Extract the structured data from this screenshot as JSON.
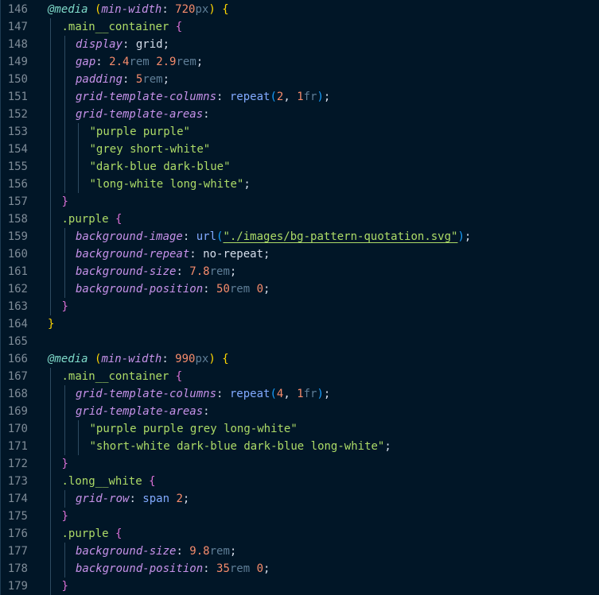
{
  "editor": {
    "theme_colors": {
      "background": "#011627",
      "line_number": "#7f8c98",
      "at_rule": "#7fdbca",
      "property": "#c792ea",
      "selector": "#addb67",
      "number": "#f78c6c",
      "unit": "#5f7e97",
      "string": "#addb67",
      "function": "#82aaff",
      "brace_level_1": "#ffd700",
      "brace_level_2": "#da70d6",
      "brace_level_3": "#179fff"
    },
    "lines": [
      {
        "n": "146",
        "indent": 0,
        "tokens": [
          {
            "c": "at",
            "t": "@media"
          },
          {
            "c": "punct",
            "t": " "
          },
          {
            "c": "brace1",
            "t": "("
          },
          {
            "c": "prop",
            "t": "min-width"
          },
          {
            "c": "punct",
            "t": ": "
          },
          {
            "c": "num",
            "t": "720"
          },
          {
            "c": "unit",
            "t": "px"
          },
          {
            "c": "brace1",
            "t": ")"
          },
          {
            "c": "punct",
            "t": " "
          },
          {
            "c": "brace1",
            "t": "{"
          }
        ]
      },
      {
        "n": "147",
        "indent": 1,
        "tokens": [
          {
            "c": "sel",
            "t": ".main__container"
          },
          {
            "c": "punct",
            "t": " "
          },
          {
            "c": "brace2",
            "t": "{"
          }
        ]
      },
      {
        "n": "148",
        "indent": 2,
        "tokens": [
          {
            "c": "prop",
            "t": "display"
          },
          {
            "c": "punct",
            "t": ": "
          },
          {
            "c": "val",
            "t": "grid"
          },
          {
            "c": "punct",
            "t": ";"
          }
        ]
      },
      {
        "n": "149",
        "indent": 2,
        "tokens": [
          {
            "c": "prop",
            "t": "gap"
          },
          {
            "c": "punct",
            "t": ": "
          },
          {
            "c": "num",
            "t": "2.4"
          },
          {
            "c": "unit",
            "t": "rem"
          },
          {
            "c": "punct",
            "t": " "
          },
          {
            "c": "num",
            "t": "2.9"
          },
          {
            "c": "unit",
            "t": "rem"
          },
          {
            "c": "punct",
            "t": ";"
          }
        ]
      },
      {
        "n": "150",
        "indent": 2,
        "tokens": [
          {
            "c": "prop",
            "t": "padding"
          },
          {
            "c": "punct",
            "t": ": "
          },
          {
            "c": "num",
            "t": "5"
          },
          {
            "c": "unit",
            "t": "rem"
          },
          {
            "c": "punct",
            "t": ";"
          }
        ]
      },
      {
        "n": "151",
        "indent": 2,
        "tokens": [
          {
            "c": "prop",
            "t": "grid-template-columns"
          },
          {
            "c": "punct",
            "t": ": "
          },
          {
            "c": "func",
            "t": "repeat"
          },
          {
            "c": "brace3",
            "t": "("
          },
          {
            "c": "num",
            "t": "2"
          },
          {
            "c": "punct",
            "t": ", "
          },
          {
            "c": "num",
            "t": "1"
          },
          {
            "c": "unit",
            "t": "fr"
          },
          {
            "c": "brace3",
            "t": ")"
          },
          {
            "c": "punct",
            "t": ";"
          }
        ]
      },
      {
        "n": "152",
        "indent": 2,
        "tokens": [
          {
            "c": "prop",
            "t": "grid-template-areas"
          },
          {
            "c": "punct",
            "t": ":"
          }
        ]
      },
      {
        "n": "153",
        "indent": 3,
        "tokens": [
          {
            "c": "str",
            "t": "\"purple purple\""
          }
        ]
      },
      {
        "n": "154",
        "indent": 3,
        "tokens": [
          {
            "c": "str",
            "t": "\"grey short-white\""
          }
        ]
      },
      {
        "n": "155",
        "indent": 3,
        "tokens": [
          {
            "c": "str",
            "t": "\"dark-blue dark-blue\""
          }
        ]
      },
      {
        "n": "156",
        "indent": 3,
        "tokens": [
          {
            "c": "str",
            "t": "\"long-white long-white\""
          },
          {
            "c": "punct",
            "t": ";"
          }
        ]
      },
      {
        "n": "157",
        "indent": 1,
        "tokens": [
          {
            "c": "brace2",
            "t": "}"
          }
        ]
      },
      {
        "n": "158",
        "indent": 1,
        "tokens": [
          {
            "c": "sel",
            "t": ".purple"
          },
          {
            "c": "punct",
            "t": " "
          },
          {
            "c": "brace2",
            "t": "{"
          }
        ]
      },
      {
        "n": "159",
        "indent": 2,
        "tokens": [
          {
            "c": "prop",
            "t": "background-image"
          },
          {
            "c": "punct",
            "t": ": "
          },
          {
            "c": "func",
            "t": "url"
          },
          {
            "c": "brace3",
            "t": "("
          },
          {
            "c": "link",
            "t": "\"./images/bg-pattern-quotation.svg\""
          },
          {
            "c": "brace3",
            "t": ")"
          },
          {
            "c": "punct",
            "t": ";"
          }
        ]
      },
      {
        "n": "160",
        "indent": 2,
        "tokens": [
          {
            "c": "prop",
            "t": "background-repeat"
          },
          {
            "c": "punct",
            "t": ": "
          },
          {
            "c": "val",
            "t": "no-repeat"
          },
          {
            "c": "punct",
            "t": ";"
          }
        ]
      },
      {
        "n": "161",
        "indent": 2,
        "tokens": [
          {
            "c": "prop",
            "t": "background-size"
          },
          {
            "c": "punct",
            "t": ": "
          },
          {
            "c": "num",
            "t": "7.8"
          },
          {
            "c": "unit",
            "t": "rem"
          },
          {
            "c": "punct",
            "t": ";"
          }
        ]
      },
      {
        "n": "162",
        "indent": 2,
        "tokens": [
          {
            "c": "prop",
            "t": "background-position"
          },
          {
            "c": "punct",
            "t": ": "
          },
          {
            "c": "num",
            "t": "50"
          },
          {
            "c": "unit",
            "t": "rem"
          },
          {
            "c": "punct",
            "t": " "
          },
          {
            "c": "num",
            "t": "0"
          },
          {
            "c": "punct",
            "t": ";"
          }
        ]
      },
      {
        "n": "163",
        "indent": 1,
        "tokens": [
          {
            "c": "brace2",
            "t": "}"
          }
        ]
      },
      {
        "n": "164",
        "indent": 0,
        "tokens": [
          {
            "c": "brace1",
            "t": "}"
          }
        ]
      },
      {
        "n": "165",
        "indent": 0,
        "tokens": []
      },
      {
        "n": "166",
        "indent": 0,
        "tokens": [
          {
            "c": "at",
            "t": "@media"
          },
          {
            "c": "punct",
            "t": " "
          },
          {
            "c": "brace1",
            "t": "("
          },
          {
            "c": "prop",
            "t": "min-width"
          },
          {
            "c": "punct",
            "t": ": "
          },
          {
            "c": "num",
            "t": "990"
          },
          {
            "c": "unit",
            "t": "px"
          },
          {
            "c": "brace1",
            "t": ")"
          },
          {
            "c": "punct",
            "t": " "
          },
          {
            "c": "brace1",
            "t": "{"
          }
        ]
      },
      {
        "n": "167",
        "indent": 1,
        "tokens": [
          {
            "c": "sel",
            "t": ".main__container"
          },
          {
            "c": "punct",
            "t": " "
          },
          {
            "c": "brace2",
            "t": "{"
          }
        ]
      },
      {
        "n": "168",
        "indent": 2,
        "tokens": [
          {
            "c": "prop",
            "t": "grid-template-columns"
          },
          {
            "c": "punct",
            "t": ": "
          },
          {
            "c": "func",
            "t": "repeat"
          },
          {
            "c": "brace3",
            "t": "("
          },
          {
            "c": "num",
            "t": "4"
          },
          {
            "c": "punct",
            "t": ", "
          },
          {
            "c": "num",
            "t": "1"
          },
          {
            "c": "unit",
            "t": "fr"
          },
          {
            "c": "brace3",
            "t": ")"
          },
          {
            "c": "punct",
            "t": ";"
          }
        ]
      },
      {
        "n": "169",
        "indent": 2,
        "tokens": [
          {
            "c": "prop",
            "t": "grid-template-areas"
          },
          {
            "c": "punct",
            "t": ":"
          }
        ]
      },
      {
        "n": "170",
        "indent": 3,
        "tokens": [
          {
            "c": "str",
            "t": "\"purple purple grey long-white\""
          }
        ]
      },
      {
        "n": "171",
        "indent": 3,
        "tokens": [
          {
            "c": "str",
            "t": "\"short-white dark-blue dark-blue long-white\""
          },
          {
            "c": "punct",
            "t": ";"
          }
        ]
      },
      {
        "n": "172",
        "indent": 1,
        "tokens": [
          {
            "c": "brace2",
            "t": "}"
          }
        ]
      },
      {
        "n": "173",
        "indent": 1,
        "tokens": [
          {
            "c": "sel",
            "t": ".long__white"
          },
          {
            "c": "punct",
            "t": " "
          },
          {
            "c": "brace2",
            "t": "{"
          }
        ]
      },
      {
        "n": "174",
        "indent": 2,
        "tokens": [
          {
            "c": "prop",
            "t": "grid-row"
          },
          {
            "c": "punct",
            "t": ": "
          },
          {
            "c": "func",
            "t": "span"
          },
          {
            "c": "punct",
            "t": " "
          },
          {
            "c": "num",
            "t": "2"
          },
          {
            "c": "punct",
            "t": ";"
          }
        ]
      },
      {
        "n": "175",
        "indent": 1,
        "tokens": [
          {
            "c": "brace2",
            "t": "}"
          }
        ]
      },
      {
        "n": "176",
        "indent": 1,
        "tokens": [
          {
            "c": "sel",
            "t": ".purple"
          },
          {
            "c": "punct",
            "t": " "
          },
          {
            "c": "brace2",
            "t": "{"
          }
        ]
      },
      {
        "n": "177",
        "indent": 2,
        "tokens": [
          {
            "c": "prop",
            "t": "background-size"
          },
          {
            "c": "punct",
            "t": ": "
          },
          {
            "c": "num",
            "t": "9.8"
          },
          {
            "c": "unit",
            "t": "rem"
          },
          {
            "c": "punct",
            "t": ";"
          }
        ]
      },
      {
        "n": "178",
        "indent": 2,
        "tokens": [
          {
            "c": "prop",
            "t": "background-position"
          },
          {
            "c": "punct",
            "t": ": "
          },
          {
            "c": "num",
            "t": "35"
          },
          {
            "c": "unit",
            "t": "rem"
          },
          {
            "c": "punct",
            "t": " "
          },
          {
            "c": "num",
            "t": "0"
          },
          {
            "c": "punct",
            "t": ";"
          }
        ]
      },
      {
        "n": "179",
        "indent": 1,
        "tokens": [
          {
            "c": "brace2",
            "t": "}"
          }
        ]
      }
    ]
  }
}
